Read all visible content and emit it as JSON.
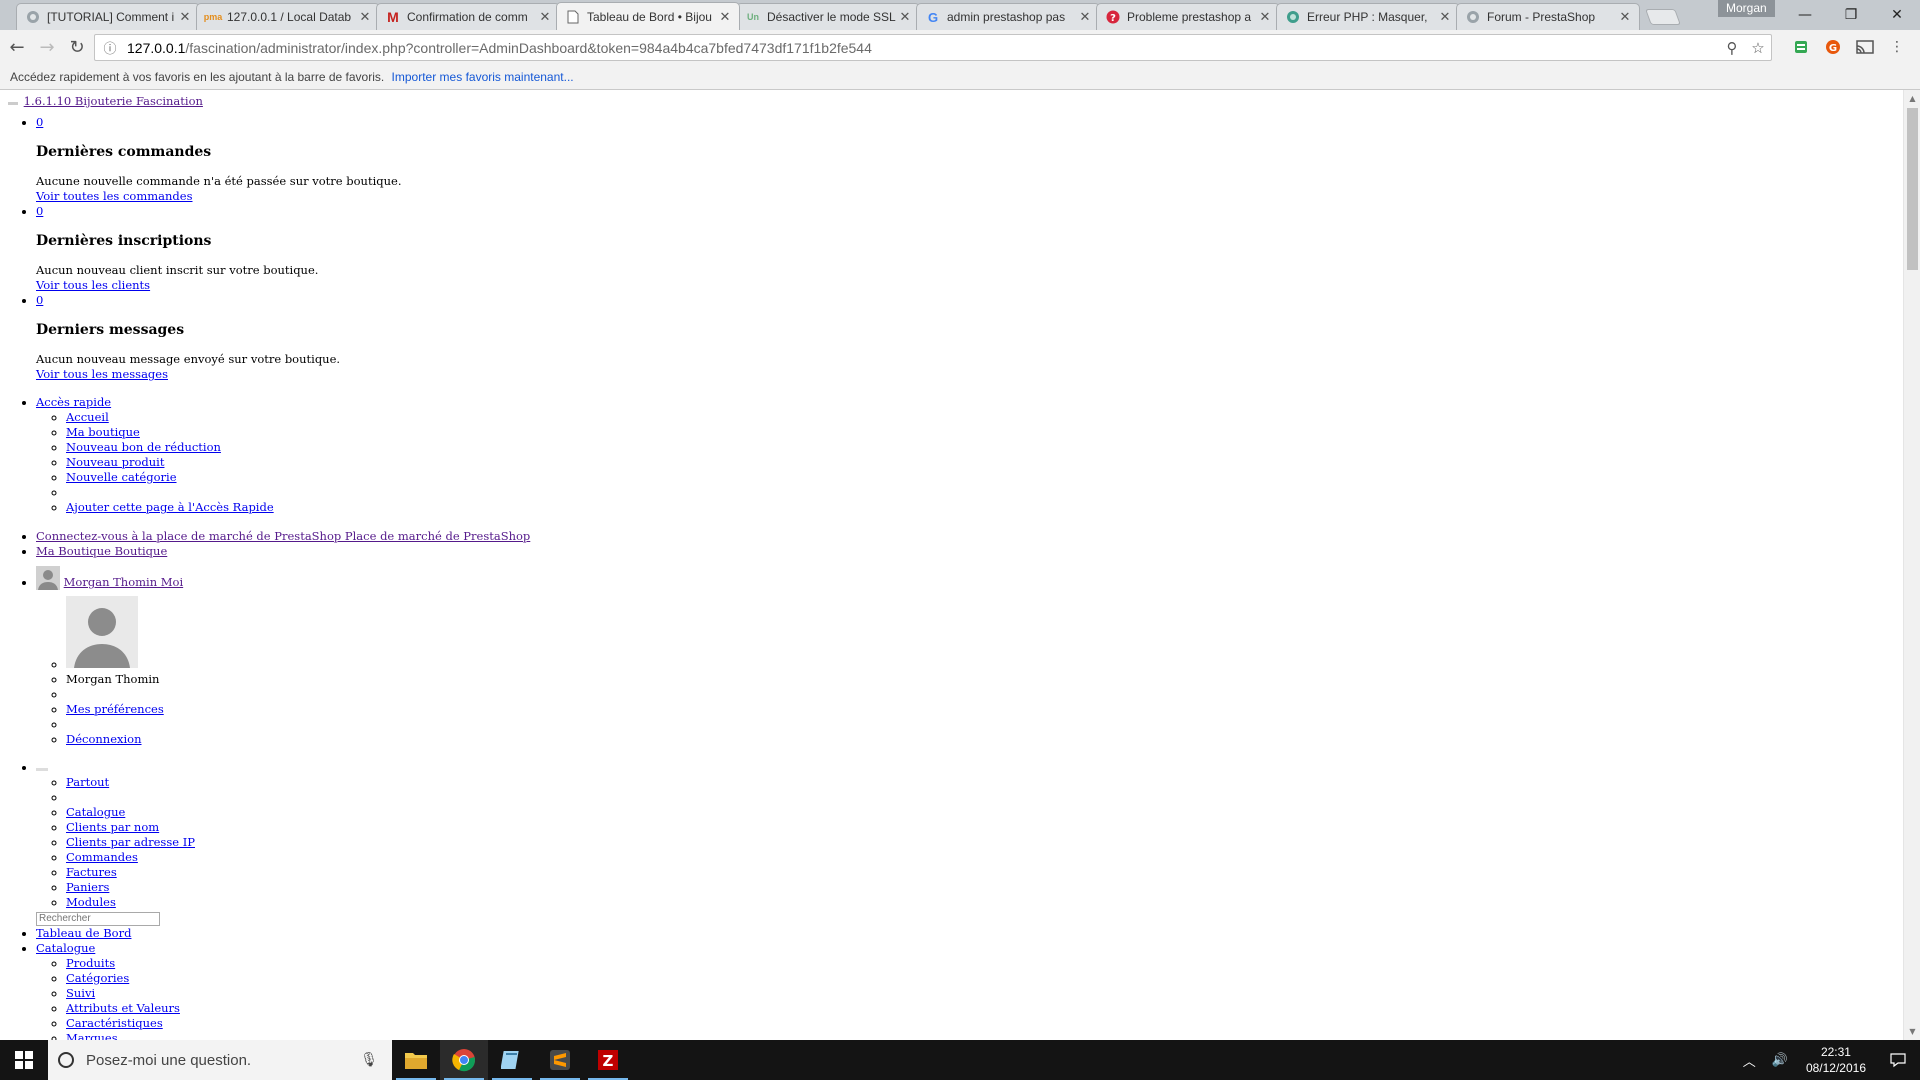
{
  "browser": {
    "tabs": [
      {
        "title": "[TUTORIAL] Comment i",
        "favicon": "prestashop-icon"
      },
      {
        "title": "127.0.0.1 / Local Datab",
        "favicon": "phpmyadmin-icon"
      },
      {
        "title": "Confirmation de comm",
        "favicon": "gmail-icon"
      },
      {
        "title": "Tableau de Bord • Bijou",
        "favicon": "page-icon"
      },
      {
        "title": "Désactiver le mode SSL",
        "favicon": "site-icon"
      },
      {
        "title": "admin prestashop pas",
        "favicon": "google-icon"
      },
      {
        "title": "Probleme prestashop a",
        "favicon": "help-icon"
      },
      {
        "title": "Erreur PHP : Masquer,",
        "favicon": "globe-icon"
      },
      {
        "title": "Forum - PrestaShop",
        "favicon": "prestashop-icon"
      }
    ],
    "profile_name": "Morgan",
    "url_host": "127.0.0.1",
    "url_rest": "/fascination/administrator/index.php?controller=AdminDashboard&token=984a4b4ca7bfed7473df171f1b2fe544",
    "bookmarks_text": "Accédez rapidement à vos favoris en les ajoutant à la barre de favoris.",
    "bookmarks_link": "Importer mes favoris maintenant..."
  },
  "page": {
    "brand": "1.6.1.10 Bijouterie Fascination",
    "notifications": [
      {
        "count": "0",
        "heading": "Dernières commandes",
        "message": "Aucune nouvelle commande n'a été passée sur votre boutique.",
        "link": "Voir toutes les commandes"
      },
      {
        "count": "0",
        "heading": "Dernières inscriptions",
        "message": "Aucun nouveau client inscrit sur votre boutique.",
        "link": "Voir tous les clients"
      },
      {
        "count": "0",
        "heading": "Derniers messages",
        "message": "Aucun nouveau message envoyé sur votre boutique.",
        "link": "Voir tous les messages"
      }
    ],
    "quick_access": {
      "label": "Accès rapide",
      "items": [
        "Accueil",
        "Ma boutique",
        "Nouveau bon de réduction",
        "Nouveau produit",
        "Nouvelle catégorie"
      ],
      "add": "Ajouter cette page à l'Accès Rapide"
    },
    "marketplace": "Connectez-vous à la place de marché de PrestaShop Place de marché de PrestaShop",
    "my_shop": "Ma Boutique Boutique",
    "employee": {
      "link": "Morgan Thomin Moi",
      "name": "Morgan Thomin",
      "preferences": "Mes préférences",
      "logout": "Déconnexion"
    },
    "search": {
      "scopes": [
        "Partout",
        "Catalogue",
        "Clients par nom",
        "Clients par adresse IP",
        "Commandes",
        "Factures",
        "Paniers",
        "Modules"
      ],
      "placeholder": "Rechercher"
    },
    "menu": {
      "dashboard": "Tableau de Bord",
      "catalog": "Catalogue",
      "catalog_items": [
        "Produits",
        "Catégories",
        "Suivi",
        "Attributs et Valeurs",
        "Caractéristiques",
        "Marques"
      ]
    }
  },
  "taskbar": {
    "search_placeholder": "Posez-moi une question.",
    "time": "22:31",
    "date": "08/12/2016"
  }
}
